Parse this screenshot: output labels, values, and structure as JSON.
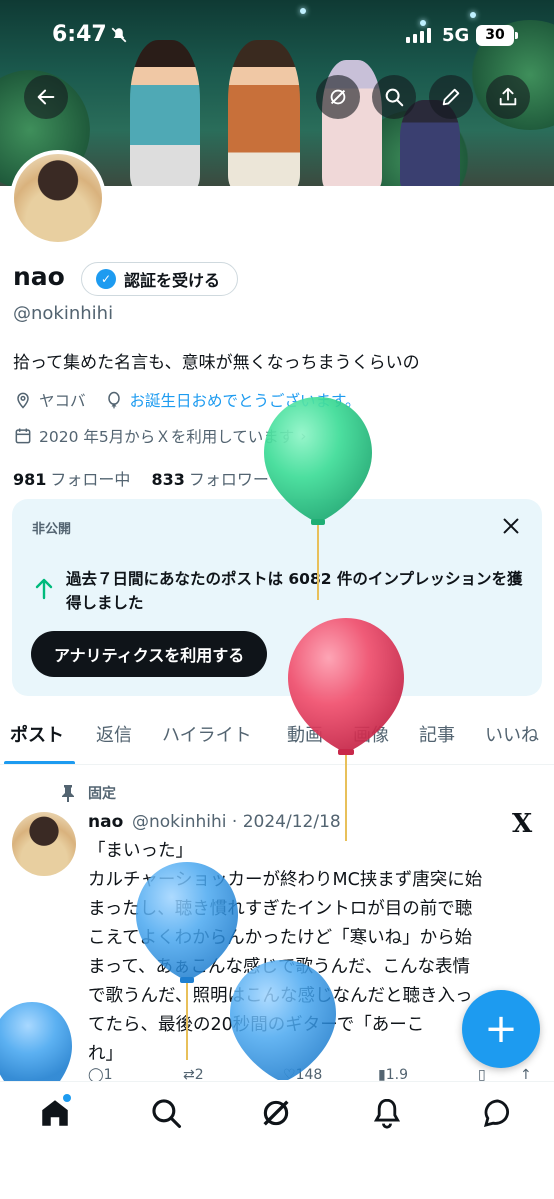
{
  "status_bar": {
    "time": "6:47",
    "network": "5G",
    "battery": "30"
  },
  "profile": {
    "name": "nao",
    "verify_button": "認証を受ける",
    "handle": "@nokinhihi",
    "bio": "拾って集めた名言も、意味が無くなっちまうくらいの",
    "location": "ヤコバ",
    "birthday": "お誕生日おめでとうございます。",
    "joined": "2020 年5月からＸを利用しています",
    "following_count": "981",
    "following_label": "フォロー中",
    "followers_count": "833",
    "followers_label": "フォロワー"
  },
  "analytics_card": {
    "label": "非公開",
    "text": "過去７日間にあなたのポストは 6082 件のインプレッションを獲得しました",
    "button": "アナリティクスを利用する"
  },
  "tabs": [
    "ポスト",
    "返信",
    "ハイライト",
    "動画",
    "画像",
    "記事",
    "いいね"
  ],
  "pinned_post": {
    "pinned_label": "固定",
    "name": "nao",
    "handle_date": "@nokinhihi · 2024/12/18",
    "lines": [
      "「まいった」",
      "カルチャーショッカーが終わりMC挟まず唐突に始",
      "まったし、聴き慣れすぎたイントロが目の前で聴",
      "こえてよくわからんかったけど「寒いね」から始",
      "まって、あぁこんな感じで歌うんだ、こんな表情",
      "で歌うんだ、照明はこんな感じなんだと聴き入っ",
      "てたら、最後の20秒間のギターで「あーこ",
      "れ」"
    ],
    "replies": "1",
    "reposts": "2",
    "likes": "148",
    "views": "1.9万"
  },
  "colors": {
    "accent": "#1d9bf0",
    "balloon_green": "#3ddc97",
    "balloon_pink": "#f0506e",
    "balloon_blue": "#4aa8f0"
  }
}
